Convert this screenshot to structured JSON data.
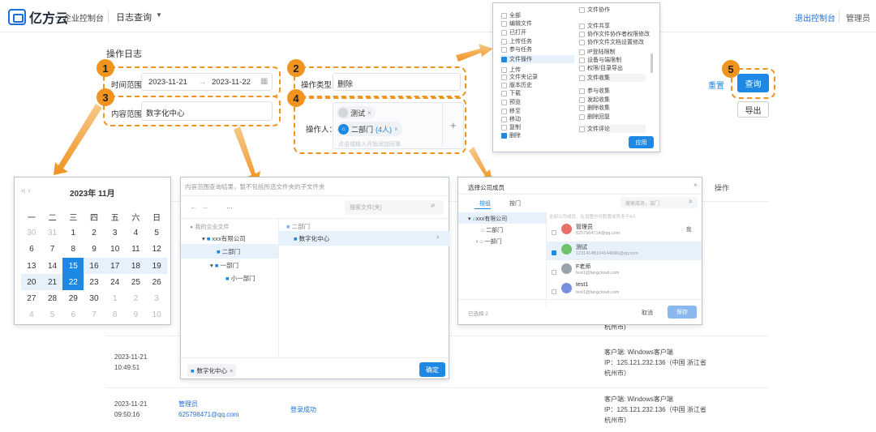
{
  "header": {
    "logo": "亿方云",
    "console": "企业控制台",
    "page": "日志查询",
    "exit": "退出控制台",
    "admin": "管理员"
  },
  "page_title": "操作日志",
  "filters": {
    "time_label": "时间范围：",
    "date_from": "2023-11-21",
    "date_sep": "→",
    "date_to": "2023-11-22",
    "optype_label": "操作类型：",
    "optype_value": "删除",
    "scope_label": "内容范围：",
    "scope_value": "数字化中心",
    "operator_label": "操作人：",
    "operator_chip1": "测试",
    "operator_chip2": "二部门",
    "operator_chip2_count": "(4人)",
    "operator_placeholder": "点击或输入开始添加同事",
    "plus": "+",
    "reset": "重置",
    "search": "查询",
    "export": "导出"
  },
  "badges": [
    "1",
    "2",
    "3",
    "4",
    "5"
  ],
  "calendar": {
    "nav_prev": "« ‹",
    "month": "2023年  11月",
    "weekdays": [
      "一",
      "二",
      "三",
      "四",
      "五",
      "六",
      "日"
    ],
    "days": [
      [
        "30",
        "31",
        "1",
        "2",
        "3",
        "4",
        "5"
      ],
      [
        "6",
        "7",
        "8",
        "9",
        "10",
        "11",
        "12"
      ],
      [
        "13",
        "14",
        "15",
        "16",
        "17",
        "18",
        "19"
      ],
      [
        "20",
        "21",
        "22",
        "23",
        "24",
        "25",
        "26"
      ],
      [
        "27",
        "28",
        "29",
        "30",
        "1",
        "2",
        "3"
      ],
      [
        "4",
        "5",
        "6",
        "7",
        "8",
        "9",
        "10"
      ]
    ]
  },
  "optype_panel": {
    "col1": [
      "全部",
      "编辑文件",
      "已打开",
      "上传任务",
      "参与任务",
      "文件操作",
      "上传",
      "文件夹记录",
      "版本历史",
      "下载",
      "预览",
      "移至",
      "移动",
      "复制",
      "删除"
    ],
    "col2": [
      "文件协作",
      "文件共享",
      "协作文件协作者权限修改",
      "协作文件文档设置修改",
      "IP登陆限制",
      "设备与端限制",
      "权限/目录导出",
      "文件收集",
      "参与收集",
      "发起收集",
      "删除收集",
      "删除回复",
      "文件评论"
    ],
    "apply": "应用"
  },
  "scope_panel": {
    "hint": "内容范围查询结果，暂不包括所选文件夹的子文件夹",
    "search_placeholder": "搜索文件(夹)",
    "tree": [
      "我的企业文件",
      "xxx有限公司",
      "二部门",
      "一部门",
      "小一部门"
    ],
    "right": [
      "二部门",
      "数字化中心"
    ],
    "chip": "数字化中心",
    "confirm": "确定"
  },
  "dept_panel": {
    "title": "选择公司成员",
    "tab1": "按组",
    "tab2": "按门",
    "search": "搜索成员，或门",
    "hint": "全部公司成员，在设置中可配置成员多于4人",
    "tree": [
      "xxx有限公司",
      "二部门",
      "一部门"
    ],
    "members": [
      {
        "name": "管理员",
        "email": "6257964714@qq.com",
        "tag": "我",
        "color": "#e8706a"
      },
      {
        "name": "测试",
        "email": "1231414B1041446B6@qq.com",
        "tag": "",
        "color": "#6ec26a"
      },
      {
        "name": "F老师",
        "email": "test1@fangcloud.com",
        "tag": "",
        "color": "#9aa3ad"
      },
      {
        "name": "test1",
        "email": "test1@fangcloud.com",
        "tag": "",
        "color": "#7a8ee0"
      }
    ],
    "selected": "已选择 2",
    "cancel": "取消",
    "save": "保存"
  },
  "table": {
    "col_op": "操作",
    "rows": [
      {
        "time": "2023-11-21",
        "clock": "10:49:51",
        "user": "",
        "email": "",
        "action": "",
        "client": "客户端: Windows客户端",
        "ip": "IP：125.121.232.136（中国 浙江省",
        "city": "杭州市）"
      },
      {
        "time": "2023-11-21",
        "clock": "09:50:16",
        "user": "管理员",
        "email": "625798471@qq.com",
        "action": "登录成功",
        "client": "客户端: Windows客户端",
        "ip": "IP：125.121.232.136（中国 浙江省",
        "city": "杭州市）"
      }
    ],
    "partial": "杭州市)"
  }
}
